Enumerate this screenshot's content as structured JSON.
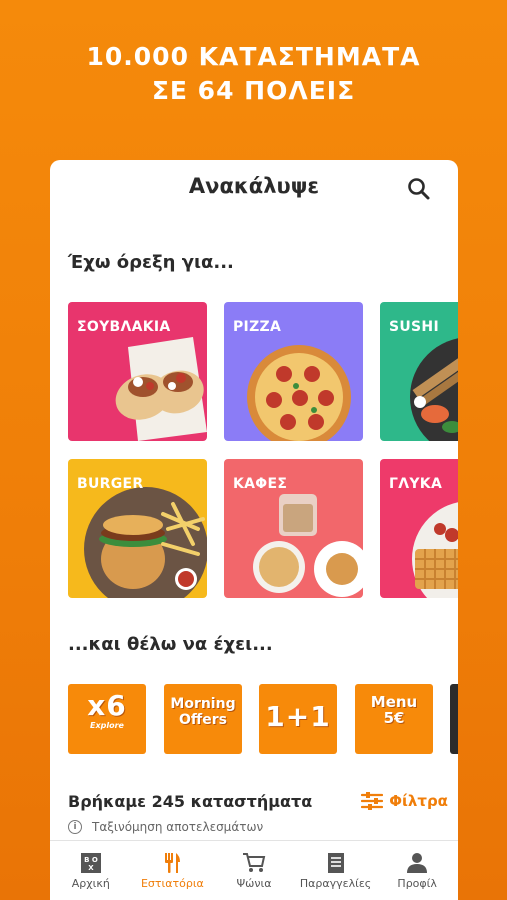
{
  "promo": {
    "line1": "10.000 ΚΑΤΑΣΤΗΜΑΤΑ",
    "line2": "ΣΕ 64 ΠΟΛΕΙΣ"
  },
  "header": {
    "title": "Ανακάλυψε",
    "search_icon": "search-icon"
  },
  "cravings": {
    "heading": "Έχω όρεξη για...",
    "categories": [
      {
        "label": "ΣΟΥΒΛΑΚΙΑ",
        "color": "#E8356D"
      },
      {
        "label": "PIZZA",
        "color": "#8B7CF6"
      },
      {
        "label": "SUSHI",
        "color": "#2EB88A"
      },
      {
        "label": "BURGER",
        "color": "#F6B91C"
      },
      {
        "label": "ΚΑΦΕΣ",
        "color": "#F2676B"
      },
      {
        "label": "ΓΛΥΚΑ",
        "color": "#EE3A6A"
      }
    ]
  },
  "features": {
    "heading": "...και θέλω να έχει...",
    "offers": [
      {
        "big": "x6",
        "small": "Explore"
      },
      {
        "line1": "Morning",
        "line2": "Offers"
      },
      {
        "big": "1+1"
      },
      {
        "line1": "Menu",
        "line2": "5€"
      }
    ]
  },
  "results": {
    "count_text": "Βρήκαμε 245 καταστήματα",
    "filters_label": "Φίλτρα",
    "sort_label": "Ταξινόμηση αποτελεσμάτων"
  },
  "nav": {
    "items": [
      {
        "label": "Αρχική",
        "icon": "box-icon"
      },
      {
        "label": "Εστιατόρια",
        "icon": "cutlery-icon"
      },
      {
        "label": "Ψώνια",
        "icon": "cart-icon"
      },
      {
        "label": "Παραγγελίες",
        "icon": "orders-icon"
      },
      {
        "label": "Προφίλ",
        "icon": "profile-icon"
      }
    ],
    "active_index": 1
  },
  "colors": {
    "accent": "#F07E0A",
    "background": "#F58A0B"
  }
}
